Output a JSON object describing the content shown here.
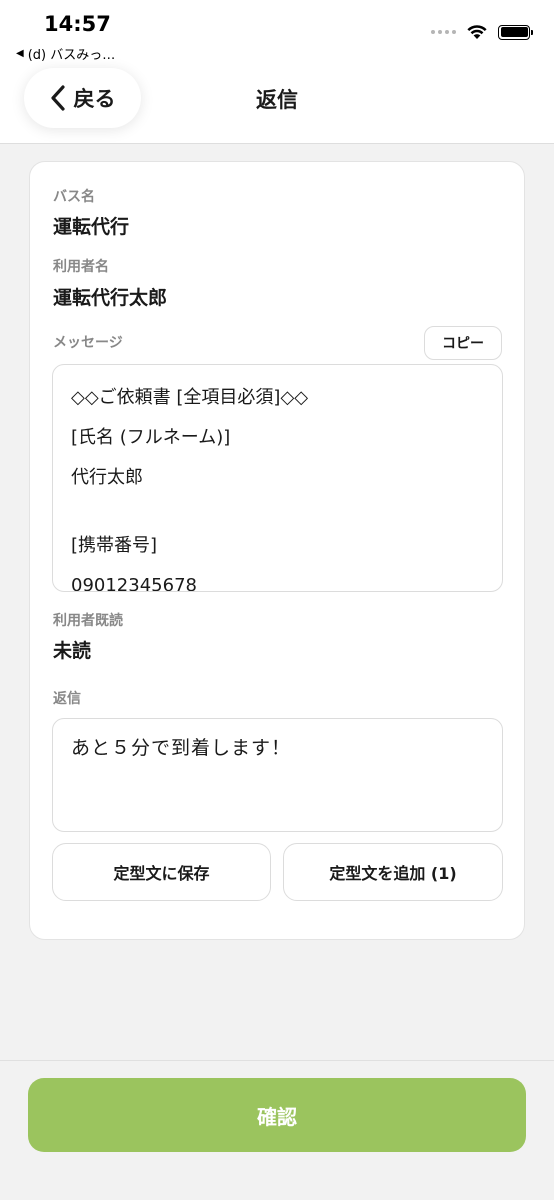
{
  "status_bar": {
    "time": "14:57",
    "back_app": "(d) バスみっ…"
  },
  "header": {
    "back_label": "戻る",
    "title": "返信"
  },
  "card": {
    "bus_name_label": "バス名",
    "bus_name_value": "運転代行",
    "user_name_label": "利用者名",
    "user_name_value": "運転代行太郎",
    "message_label": "メッセージ",
    "copy_label": "コピー",
    "message_lines": [
      "◇◇ご依頼書 [全項目必須]◇◇",
      "[氏名 (フルネーム)]",
      "代行太郎",
      "",
      "[携帯番号]",
      "09012345678"
    ],
    "read_label": "利用者既読",
    "read_value": "未読",
    "reply_label": "返信",
    "reply_value": "あと５分で到着します！",
    "save_template_label": "定型文に保存",
    "add_template_label": "定型文を追加 (1)"
  },
  "footer": {
    "confirm_label": "確認"
  },
  "colors": {
    "confirm_button": "#9bc45e",
    "background": "#f2f2f2"
  }
}
